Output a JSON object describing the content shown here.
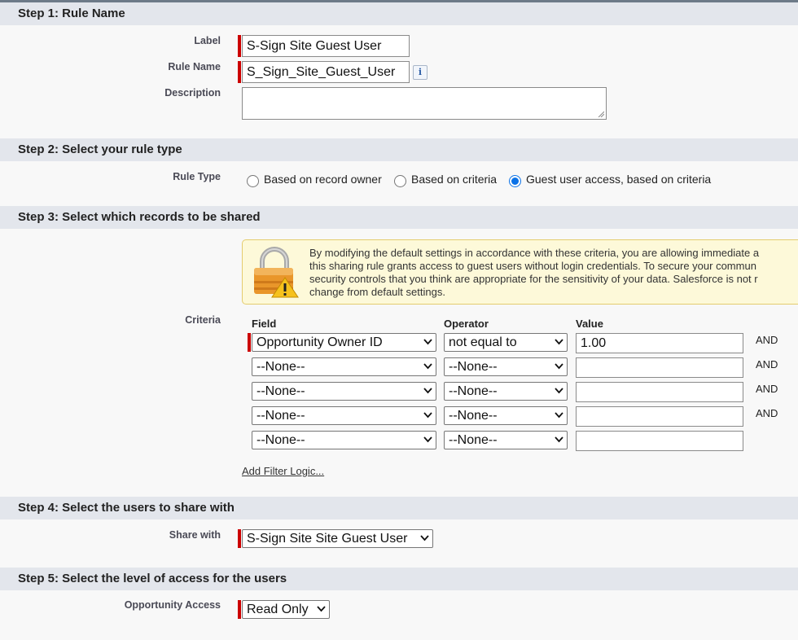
{
  "step1": {
    "header": "Step 1: Rule Name",
    "label_label": "Label",
    "label_value": "S-Sign Site Guest User",
    "rule_name_label": "Rule Name",
    "rule_name_value": "S_Sign_Site_Guest_User",
    "info_glyph": "i",
    "description_label": "Description",
    "description_value": ""
  },
  "step2": {
    "header": "Step 2: Select your rule type",
    "rule_type_label": "Rule Type",
    "options": [
      {
        "label": "Based on record owner",
        "selected": false
      },
      {
        "label": "Based on criteria",
        "selected": false
      },
      {
        "label": "Guest user access, based on criteria",
        "selected": true
      }
    ]
  },
  "step3": {
    "header": "Step 3: Select which records to be shared",
    "warning_icon": "lock-warning-icon",
    "warning_lines": [
      "By modifying the default settings in accordance with these criteria, you are allowing immediate a",
      "this sharing rule grants access to guest users without login credentials. To secure your commun",
      "security controls that you think are appropriate for the sensitivity of your data. Salesforce is not r",
      "change from default settings."
    ],
    "criteria_label": "Criteria",
    "columns": {
      "field": "Field",
      "operator": "Operator",
      "value": "Value"
    },
    "rows": [
      {
        "field": "Opportunity Owner ID",
        "operator": "not equal to",
        "value": "1.00",
        "conj": "AND"
      },
      {
        "field": "--None--",
        "operator": "--None--",
        "value": "",
        "conj": "AND"
      },
      {
        "field": "--None--",
        "operator": "--None--",
        "value": "",
        "conj": "AND"
      },
      {
        "field": "--None--",
        "operator": "--None--",
        "value": "",
        "conj": "AND"
      },
      {
        "field": "--None--",
        "operator": "--None--",
        "value": "",
        "conj": ""
      }
    ],
    "add_filter_logic": "Add Filter Logic..."
  },
  "step4": {
    "header": "Step 4: Select the users to share with",
    "share_with_label": "Share with",
    "share_with_value": "S-Sign Site Site Guest User"
  },
  "step5": {
    "header": "Step 5: Select the level of access for the users",
    "access_label": "Opportunity Access",
    "access_value": "Read Only"
  },
  "colors": {
    "header_bg": "#e3e6ec",
    "required": "#cc0000",
    "radio_selected": "#0b72e7",
    "warning_bg": "#fdf9d9"
  }
}
